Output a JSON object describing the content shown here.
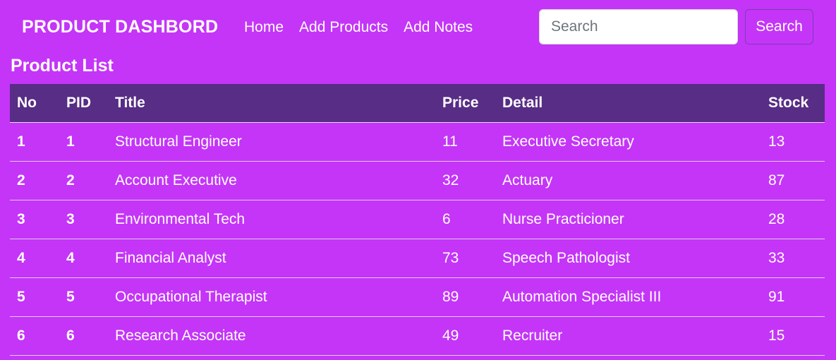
{
  "navbar": {
    "brand": "PRODUCT DASHBORD",
    "links": [
      "Home",
      "Add Products",
      "Add Notes"
    ],
    "search_placeholder": "Search",
    "search_button": "Search"
  },
  "page": {
    "title": "Product List"
  },
  "table": {
    "headers": [
      "No",
      "PID",
      "Title",
      "Price",
      "Detail",
      "Stock"
    ],
    "rows": [
      [
        "1",
        "1",
        "Structural Engineer",
        "11",
        "Executive Secretary",
        "13"
      ],
      [
        "2",
        "2",
        "Account Executive",
        "32",
        "Actuary",
        "87"
      ],
      [
        "3",
        "3",
        "Environmental Tech",
        "6",
        "Nurse Practicioner",
        "28"
      ],
      [
        "4",
        "4",
        "Financial Analyst",
        "73",
        "Speech Pathologist",
        "33"
      ],
      [
        "5",
        "5",
        "Occupational Therapist",
        "89",
        "Automation Specialist III",
        "91"
      ],
      [
        "6",
        "6",
        "Research Associate",
        "49",
        "Recruiter",
        "15"
      ]
    ]
  },
  "colors": {
    "background": "#c435f7",
    "table_header": "#572d85",
    "text": "#ffffff"
  }
}
